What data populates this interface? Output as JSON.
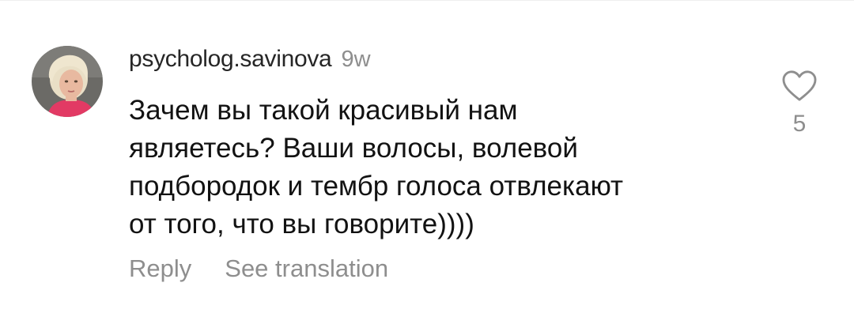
{
  "comment": {
    "username": "psycholog.savinova",
    "time": "9w",
    "text": "Зачем вы такой красивый нам\nявляетесь? Ваши волосы, волевой\nподбородок и тембр голоса отвлекают\nот того, что вы говорите))))",
    "avatar_icon": "user-avatar-photo",
    "like_icon": "heart-outline-icon",
    "like_count": "5",
    "actions": {
      "reply": "Reply",
      "see_translation": "See translation"
    }
  },
  "colors": {
    "text": "#121212",
    "secondary": "#8e8e8e",
    "background": "#ffffff"
  }
}
